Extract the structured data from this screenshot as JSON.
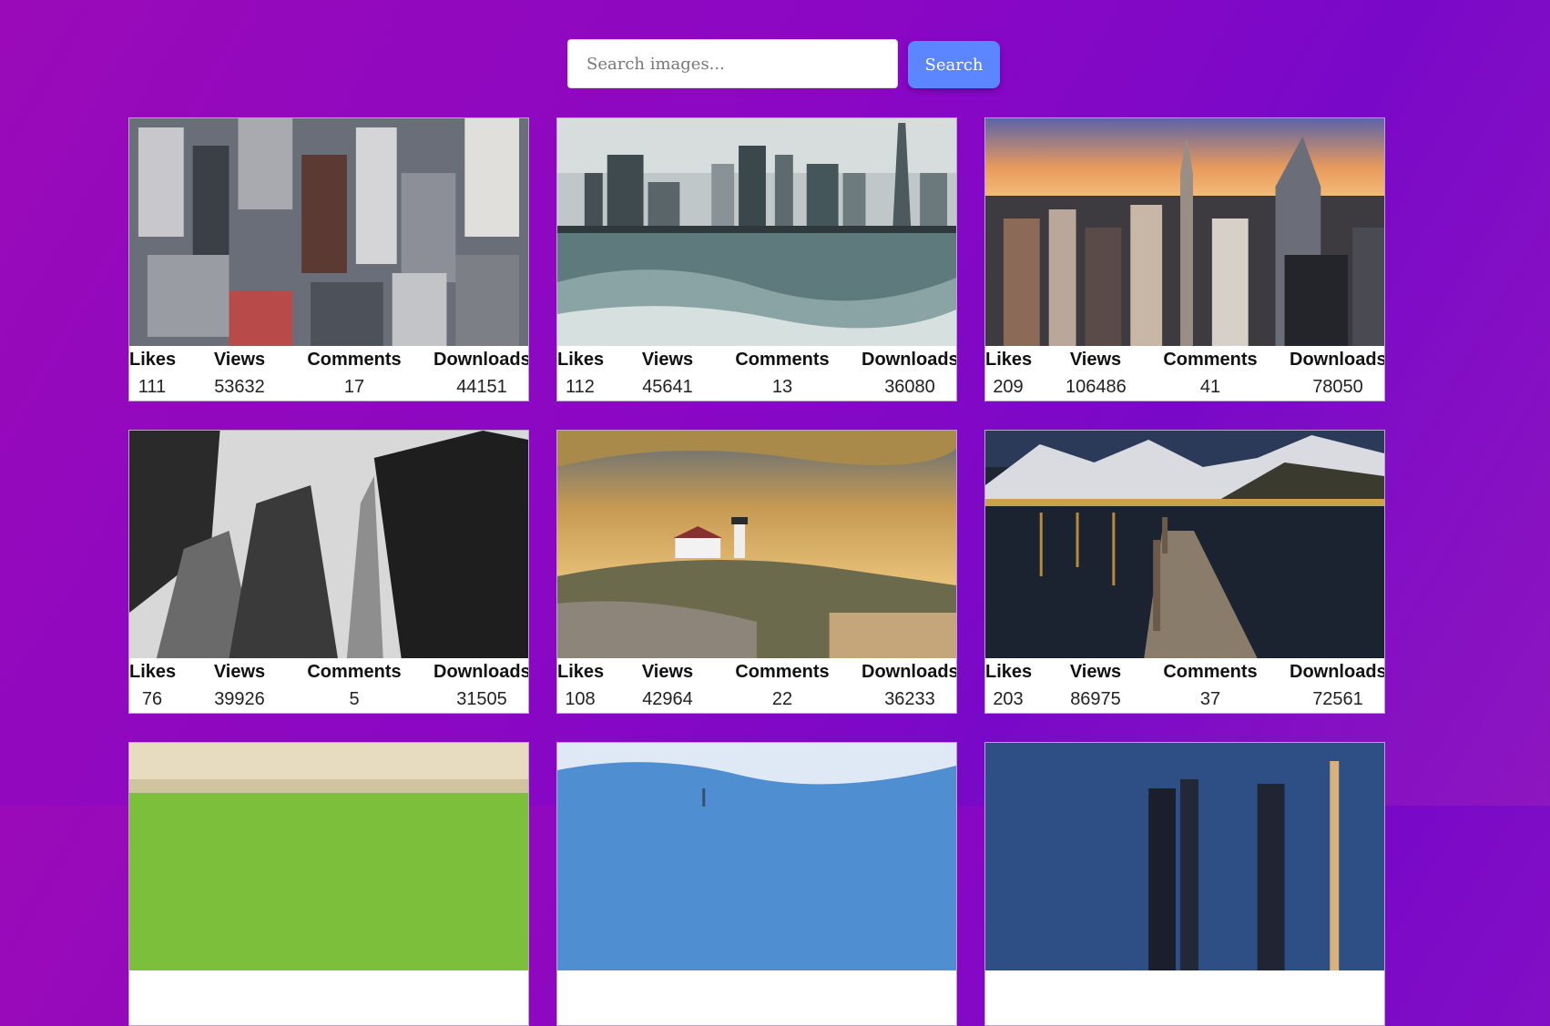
{
  "search": {
    "placeholder": "Search images...",
    "button_label": "Search"
  },
  "stat_labels": {
    "likes": "Likes",
    "views": "Views",
    "comments": "Comments",
    "downloads": "Downloads"
  },
  "cards": [
    {
      "likes": "111",
      "views": "53632",
      "comments": "17",
      "downloads": "44151"
    },
    {
      "likes": "112",
      "views": "45641",
      "comments": "13",
      "downloads": "36080"
    },
    {
      "likes": "209",
      "views": "106486",
      "comments": "41",
      "downloads": "78050"
    },
    {
      "likes": "76",
      "views": "39926",
      "comments": "5",
      "downloads": "31505"
    },
    {
      "likes": "108",
      "views": "42964",
      "comments": "22",
      "downloads": "36233"
    },
    {
      "likes": "203",
      "views": "86975",
      "comments": "37",
      "downloads": "72561"
    }
  ],
  "colors": {
    "background": "#8a07c4",
    "accent": "#5b86ff"
  }
}
